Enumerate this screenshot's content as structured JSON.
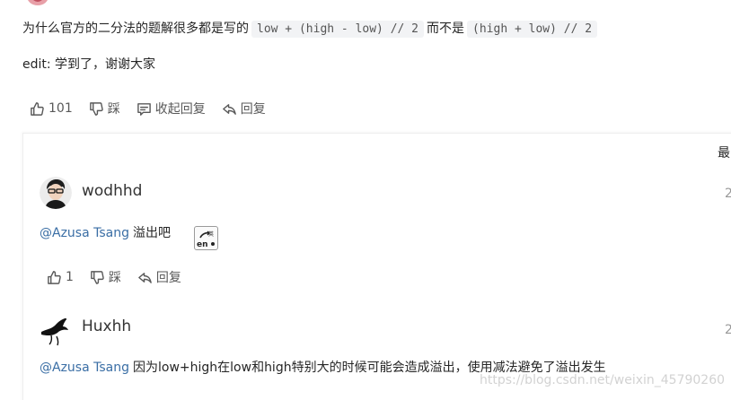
{
  "question": {
    "prefix": "为什么官方的二分法的题解很多都是写的",
    "code_a": "low + (high - low) // 2",
    "middle": "而不是",
    "code_b": "(high + low) // 2"
  },
  "edit_text": "edit: 学到了，谢谢大家",
  "post_actions": {
    "like_count": "101",
    "dislike_label": "踩",
    "collapse_label": "收起回复",
    "reply_label": "回复"
  },
  "sort_label": "最",
  "replies": [
    {
      "username": "wodhhd",
      "date_cut": "2",
      "mention": "@Azusa Tsang",
      "text": "溢出吧",
      "like_count": "1",
      "dislike_label": "踩",
      "reply_label": "回复"
    },
    {
      "username": "Huxhh",
      "date_cut": "2",
      "mention": "@Azusa Tsang",
      "text": "因为low+high在low和high特别大的时候可能会造成溢出，使用减法避免了溢出发生"
    }
  ],
  "watermark": "https://blog.csdn.net/weixin_45790260"
}
